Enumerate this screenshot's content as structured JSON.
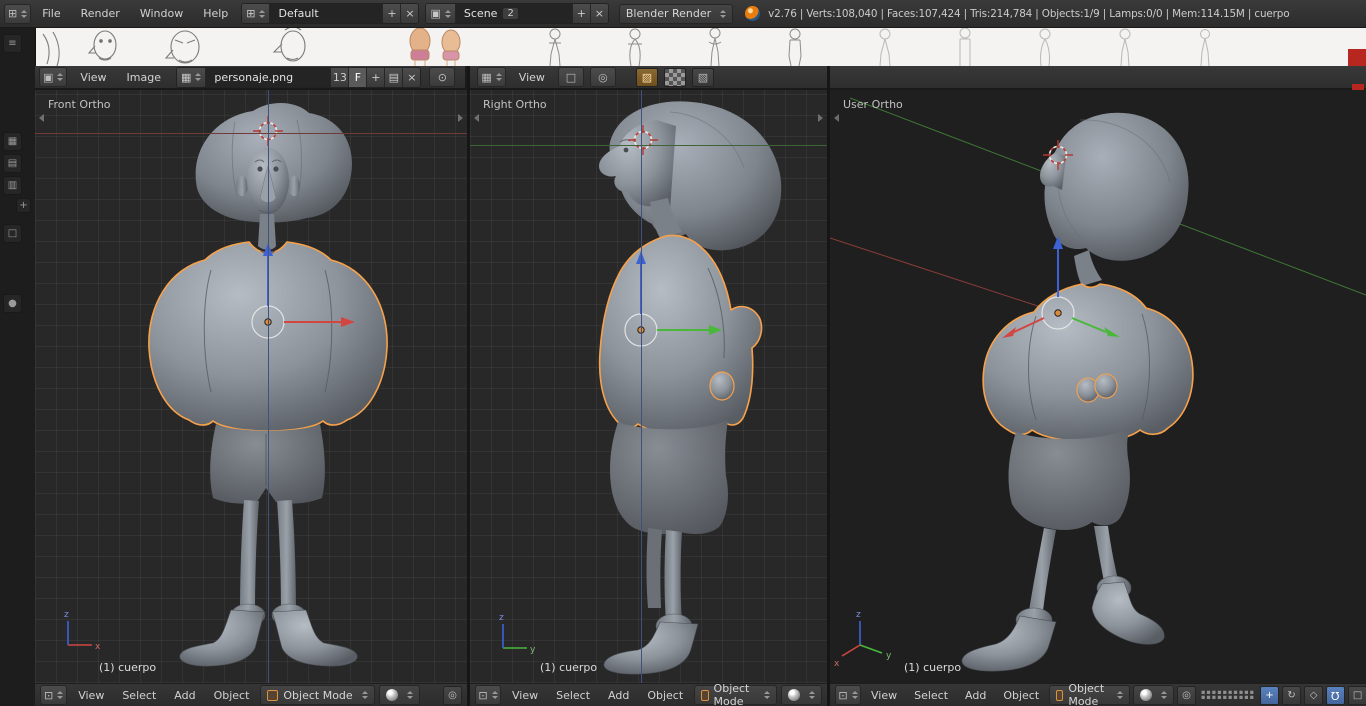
{
  "topbar": {
    "menus": [
      "File",
      "Render",
      "Window",
      "Help"
    ],
    "layout": {
      "value": "Default"
    },
    "scene": {
      "value": "Scene",
      "users": "2"
    },
    "engine": {
      "value": "Blender Render"
    },
    "stats": "v2.76 | Verts:108,040 | Faces:107,424 | Tris:214,784 | Objects:1/9 | Lamps:0/0 | Mem:114.15M | cuerpo"
  },
  "image_editor": {
    "menus": [
      "View",
      "Image"
    ],
    "image_name": "personaje.png",
    "users": "13",
    "fake_user": "F"
  },
  "uv_tools": {
    "view_menu": "View"
  },
  "viewports": [
    {
      "label": "Front Ortho",
      "status": "(1) cuerpo"
    },
    {
      "label": "Right Ortho",
      "status": "(1) cuerpo"
    },
    {
      "label": "User Ortho",
      "status": "(1) cuerpo"
    }
  ],
  "vp_menu": {
    "view": "View",
    "select": "Select",
    "add": "Add",
    "object": "Object",
    "mode": "Object Mode"
  },
  "axis": {
    "x": "x",
    "y": "y",
    "z": "z"
  },
  "icons": {
    "window": "⊞",
    "outliner": "≡",
    "image_editor": "▣",
    "view3d_editor": "⊡",
    "browse": "▦",
    "folder": "▤",
    "pin": "⊙",
    "plus": "+",
    "close": "×",
    "uv_color": "▨",
    "uv_checker": "▦",
    "uv_alpha": "▧",
    "btn_a": "□",
    "btn_b": "▣",
    "pivot": "◎",
    "translate": "+",
    "rotate": "↻",
    "scale": "◇",
    "magnet": "Ω",
    "camera": "◉",
    "layers_row": "▪▪▪▪▪▪▪▪▪▪",
    "lattice_a": "▦",
    "lattice_b": "▤",
    "lattice_c": "▥",
    "modifier": "+",
    "sphere_icon": "●"
  },
  "colors": {
    "accent_orange": "#e8912d",
    "selection_outline": "#f7a24b",
    "axis_x": "#d24540",
    "axis_y": "#49b83a",
    "axis_z": "#3c62d6"
  }
}
